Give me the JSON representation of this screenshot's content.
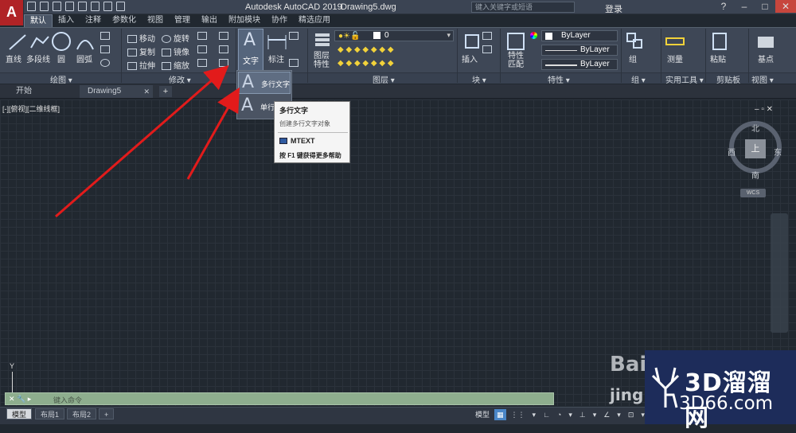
{
  "app": {
    "logo": "A",
    "title": "Autodesk AutoCAD 2019",
    "file": "Drawing5.dwg",
    "search_placeholder": "键入关键字或短语",
    "login": "登录",
    "help": "?"
  },
  "ribbon_tabs": [
    "默认",
    "插入",
    "注释",
    "参数化",
    "视图",
    "管理",
    "输出",
    "附加模块",
    "协作",
    "精选应用"
  ],
  "draw_panel": {
    "title": "绘图 ▾",
    "line": "直线",
    "polyline": "多段线",
    "circle": "圆",
    "arc": "圆弧"
  },
  "modify_panel": {
    "title": "修改 ▾",
    "move": "移动",
    "rotate": "旋转",
    "copy": "复制",
    "mirror": "镜像",
    "stretch": "拉伸",
    "scale": "缩放"
  },
  "annotation_panel": {
    "text": "文字",
    "dimension": "标注"
  },
  "layers_panel": {
    "title": "图层 ▾",
    "layer_props": "图层\n特性",
    "current_layer": "0"
  },
  "block_panel": {
    "title": "块 ▾",
    "insert": "插入"
  },
  "properties_panel": {
    "title": "特性 ▾",
    "match": "特性\n匹配",
    "color": "ByLayer",
    "linetype": "ByLayer",
    "lineweight": "ByLayer"
  },
  "groups_panel": {
    "title": "组 ▾",
    "group": "组"
  },
  "utilities_panel": {
    "title": "实用工具 ▾",
    "measure": "测量"
  },
  "clipboard_panel": {
    "title": "剪贴板",
    "paste": "粘贴"
  },
  "view_panel": {
    "title": "视图 ▾",
    "base": "基点"
  },
  "doc_tabs": [
    "开始",
    "Drawing5"
  ],
  "viewport_label": "[-][俯视][二维线框]",
  "viewcube": {
    "top": "上",
    "north": "北",
    "south": "南",
    "east": "东",
    "west": "西",
    "wcs": "WCS"
  },
  "text_dropdown": {
    "items": [
      {
        "label": "多行文字",
        "icon": "A"
      },
      {
        "label": "单行文字",
        "icon": "A"
      }
    ]
  },
  "tooltip": {
    "title": "多行文字",
    "desc": "创建多行文字对象",
    "command": "MTEXT",
    "help": "按 F1 键获得更多帮助"
  },
  "command_line": {
    "placeholder": "键入命令",
    "icons": "✕ 🔧 ▸"
  },
  "ucs_y": "Y",
  "layout_tabs": [
    "模型",
    "布局1",
    "布局2"
  ],
  "status": {
    "model": "模型",
    "items": [
      "▦",
      "⋮⋮",
      "▾",
      "∟",
      "◔",
      "▾",
      "⊥",
      "▾",
      "∠",
      "▾",
      "⊡",
      "▾"
    ]
  },
  "watermark": {
    "brand": "3D溜溜网",
    "domain": "3D66.com",
    "baidu": "Bai",
    "baidu_sub": "jing"
  },
  "colors": {
    "annotation_arrow": "#e21b1b",
    "title_bg": "#3b4453",
    "canvas_bg": "#212830",
    "accent": "#4a86c7"
  }
}
